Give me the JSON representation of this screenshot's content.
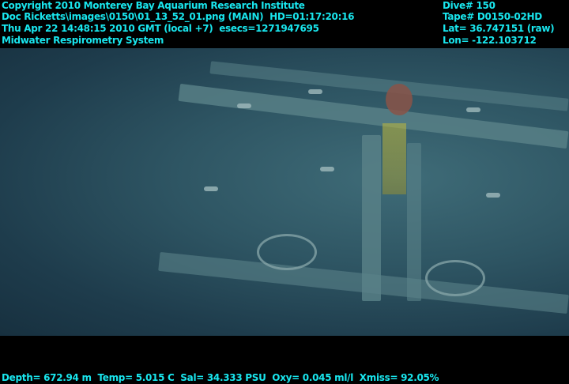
{
  "overlay_top_left": [
    "Copyright 2010 Monterey Bay Aquarium Research Institute",
    "Doc Ricketts\\images\\0150\\01_13_52_01.png (MAIN)  HD=01:17:20:16",
    "Thu Apr 22 14:48:15 2010 GMT (local +7)  esecs=1271947695",
    "Midwater Respirometry System"
  ],
  "overlay_top_right": [
    "Dive# 150",
    "Tape# D0150-02HD",
    "Lat= 36.747151 (raw)",
    "Lon= -122.103712"
  ],
  "overlay_bottom": "Depth= 672.94 m  Temp= 5.015 C  Sal= 34.333 PSU  Oxy= 0.045 ml/l  Xmiss= 92.05%",
  "colors": {
    "overlay_text": "#19e6ee",
    "water": "#2e5563"
  }
}
